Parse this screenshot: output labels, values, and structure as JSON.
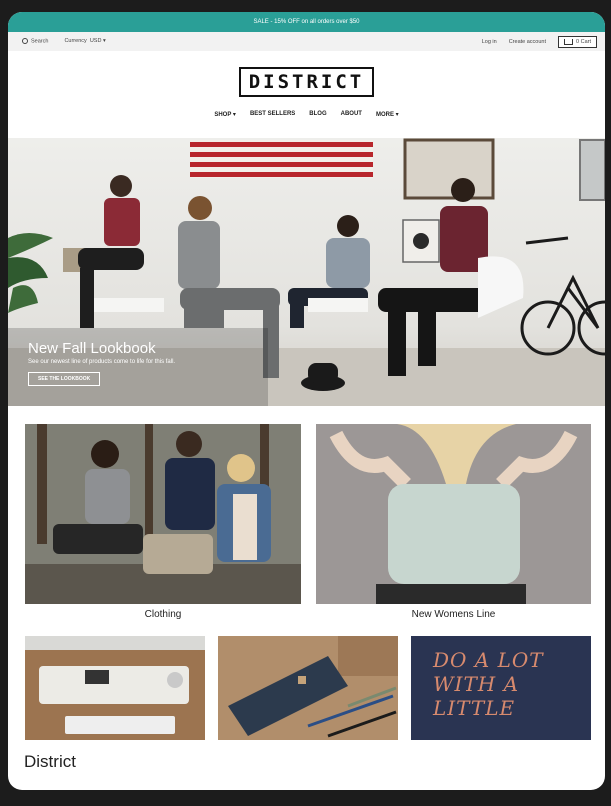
{
  "announcement": "SALE - 15% OFF on all orders over $50",
  "topbar": {
    "search_label": "Search",
    "currency_label": "Currency",
    "currency_value": "USD",
    "login_label": "Log in",
    "create_account_label": "Create account",
    "cart_label": "0 Cart"
  },
  "logo": "DISTRICT",
  "nav": {
    "items": [
      "SHOP",
      "BEST SELLERS",
      "BLOG",
      "ABOUT",
      "MORE"
    ]
  },
  "hero": {
    "title": "New Fall Lookbook",
    "subtitle": "See our newest line of products come to life for this fall.",
    "button_label": "SEE THE LOOKBOOK"
  },
  "collections": [
    {
      "label": "Clothing"
    },
    {
      "label": "New Womens Line"
    }
  ],
  "tile_text": "DO A LOT WITH A LITTLE",
  "footer_title": "District",
  "colors": {
    "accent": "#2a9f97"
  }
}
